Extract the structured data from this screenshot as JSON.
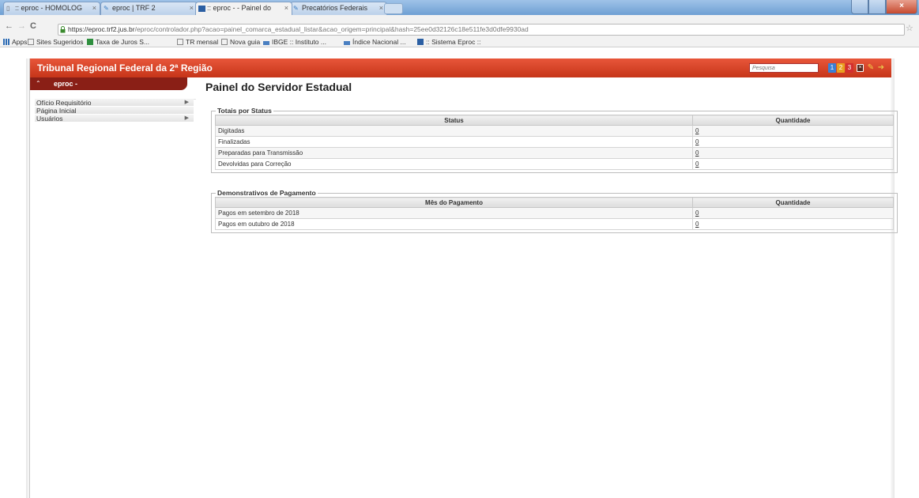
{
  "browser": {
    "tabs": [
      {
        "label": ":: eproc - HOMOLOG"
      },
      {
        "label": "eproc | TRF 2"
      },
      {
        "label": ":: eproc - - Painel do"
      },
      {
        "label": "Precatórios Federais"
      }
    ],
    "url_host": "https://eproc.trf2.jus.br",
    "url_path": "/eproc/controlador.php?acao=painel_comarca_estadual_listar&acao_origem=principal&hash=25ee0d32126c18e511fe3d0dfe9930ad",
    "bookmarks": [
      {
        "label": "Apps",
        "icon": "apps-grid-icon"
      },
      {
        "label": "Sites Sugeridos",
        "icon": "page-icon"
      },
      {
        "label": "Taxa de Juros S...",
        "icon": "bookmark-icon"
      },
      {
        "label": "TR mensal",
        "icon": "page-icon"
      },
      {
        "label": "Nova guia",
        "icon": "page-icon"
      },
      {
        "label": "IBGE :: Instituto ...",
        "icon": "ibge-icon"
      },
      {
        "label": "Índice Nacional ...",
        "icon": "ibge-icon"
      },
      {
        "label": ":: Sistema Eproc ::",
        "icon": "eproc-icon"
      }
    ]
  },
  "site": {
    "title": "Tribunal Regional Federal da 2ª Região",
    "search_placeholder": "Pesquisa",
    "brand": "eproc -",
    "badges": [
      "1",
      "2",
      "3"
    ],
    "header_color": "#d9452a"
  },
  "sidebar": {
    "items": [
      {
        "label": "Ofício Requisitório",
        "has_arrow": true
      },
      {
        "label": "Página Inicial",
        "has_arrow": false
      },
      {
        "label": "Usuários",
        "has_arrow": true
      }
    ]
  },
  "main": {
    "title": "Painel do Servidor Estadual",
    "status_section": {
      "legend": "Totais por Status",
      "col_status": "Status",
      "col_qty": "Quantidade",
      "rows": [
        {
          "status": "Digitadas",
          "qty": "0"
        },
        {
          "status": "Finalizadas",
          "qty": "0"
        },
        {
          "status": "Preparadas para Transmissão",
          "qty": "0"
        },
        {
          "status": "Devolvidas para Correção",
          "qty": "0"
        }
      ]
    },
    "payment_section": {
      "legend": "Demonstrativos de Pagamento",
      "col_month": "Mês do Pagamento",
      "col_qty": "Quantidade",
      "rows": [
        {
          "month": "Pagos em setembro de 2018",
          "qty": "0"
        },
        {
          "month": "Pagos em outubro de 2018",
          "qty": "0"
        }
      ]
    }
  }
}
